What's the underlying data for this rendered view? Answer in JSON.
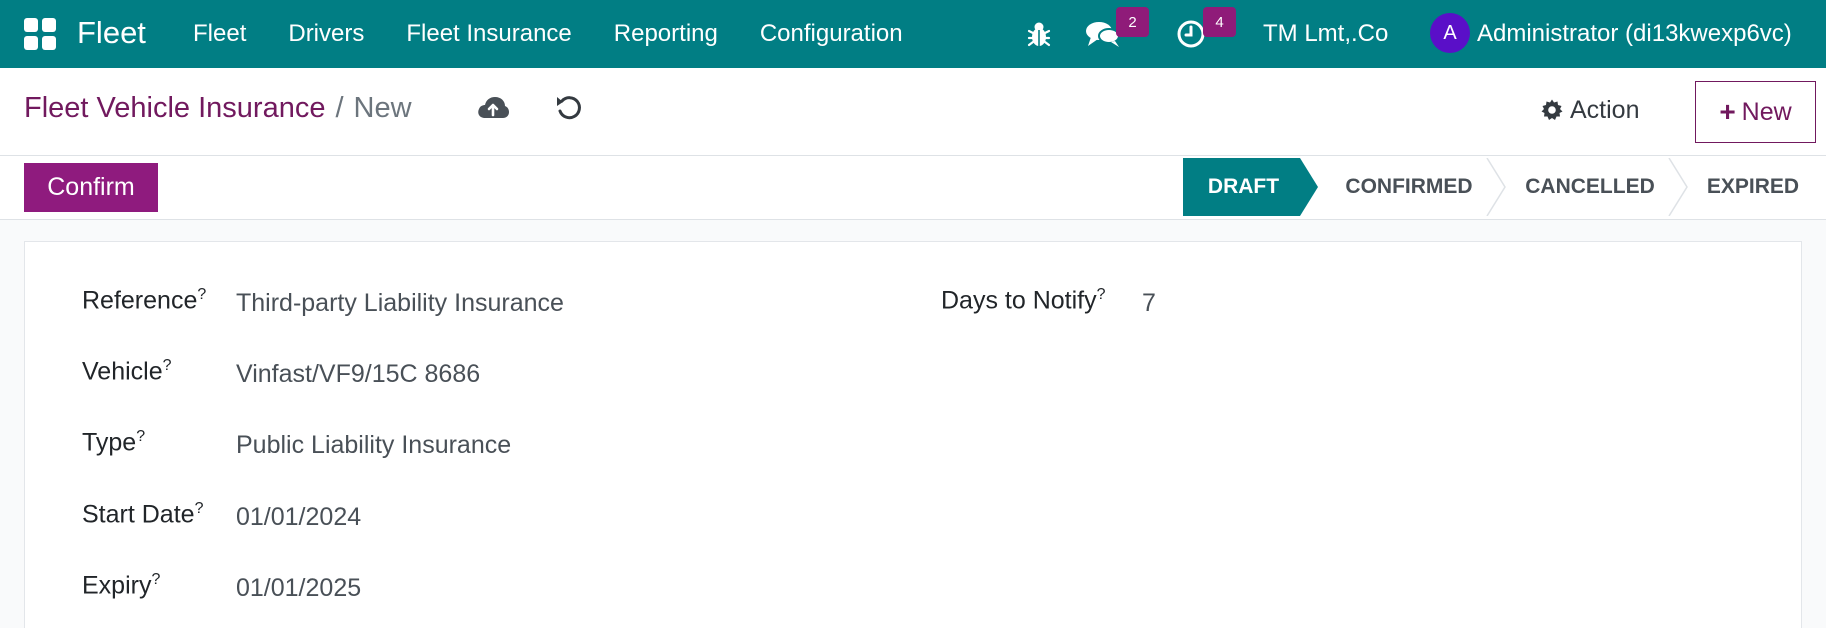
{
  "navbar": {
    "brand": "Fleet",
    "menu": [
      "Fleet",
      "Drivers",
      "Fleet Insurance",
      "Reporting",
      "Configuration"
    ],
    "messages_count": "2",
    "activities_count": "4",
    "company": "TM Lmt,.Co",
    "avatar_letter": "A",
    "user": "Administrator (di13kwexp6vc)"
  },
  "breadcrumb": {
    "parent": "Fleet Vehicle Insurance",
    "separator": "/",
    "current": "New"
  },
  "toolbar": {
    "action_label": "Action",
    "new_label": "New",
    "new_icon": "+"
  },
  "statusbar": {
    "confirm_label": "Confirm",
    "stages": [
      "DRAFT",
      "CONFIRMED",
      "CANCELLED",
      "EXPIRED"
    ],
    "active_stage": "DRAFT"
  },
  "form": {
    "help_mark": "?",
    "reference_label": "Reference",
    "reference_value": "Third-party Liability Insurance",
    "vehicle_label": "Vehicle",
    "vehicle_value": "Vinfast/VF9/15C 8686",
    "type_label": "Type",
    "type_value": "Public Liability Insurance",
    "start_label": "Start Date",
    "start_value": "01/01/2024",
    "expiry_label": "Expiry",
    "expiry_value": "01/01/2025",
    "days_label": "Days to Notify",
    "days_value": "7"
  },
  "colors": {
    "navbar": "#017e84",
    "brand_purple": "#71195e",
    "confirm_button": "#8f1b7e",
    "badge": "#8f1b79",
    "avatar": "#5a0fc8"
  },
  "icons": [
    "apps-grid-icon",
    "bug-icon",
    "chat-icon",
    "clock-icon",
    "cloud-upload-icon",
    "undo-icon",
    "gear-icon",
    "plus-icon"
  ]
}
